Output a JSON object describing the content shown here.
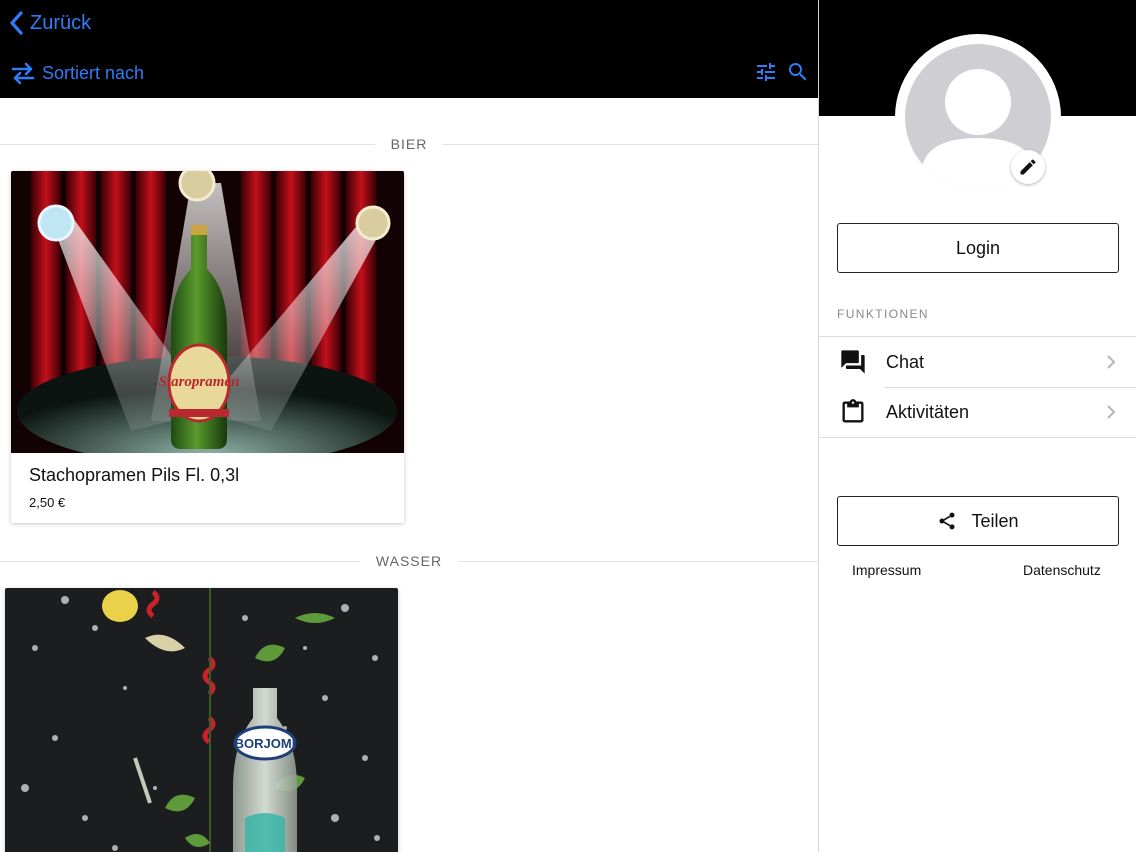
{
  "header": {
    "back_label": "Zurück",
    "sort_label": "Sortiert nach",
    "accent_color": "#2f7df6",
    "icons": [
      "chevron-left-icon",
      "swap-arrows-icon",
      "tune-icon",
      "search-icon"
    ]
  },
  "sections": [
    {
      "label": "BIER",
      "items": [
        {
          "title": "Stachopramen Pils Fl. 0,3l",
          "price": "2,50 €"
        }
      ]
    },
    {
      "label": "WASSER",
      "items": [
        {
          "title": "",
          "price": ""
        }
      ]
    }
  ],
  "product_image_text": {
    "beer_label": "Staropramen",
    "water_label": "BORJOMI"
  },
  "sidebar": {
    "login_label": "Login",
    "functions_label": "FUNKTIONEN",
    "menu": [
      {
        "label": "Chat",
        "icon": "chat-icon"
      },
      {
        "label": "Aktivitäten",
        "icon": "clipboard-icon"
      }
    ],
    "share_label": "Teilen",
    "footer": {
      "impressum": "Impressum",
      "datenschutz": "Datenschutz"
    }
  }
}
